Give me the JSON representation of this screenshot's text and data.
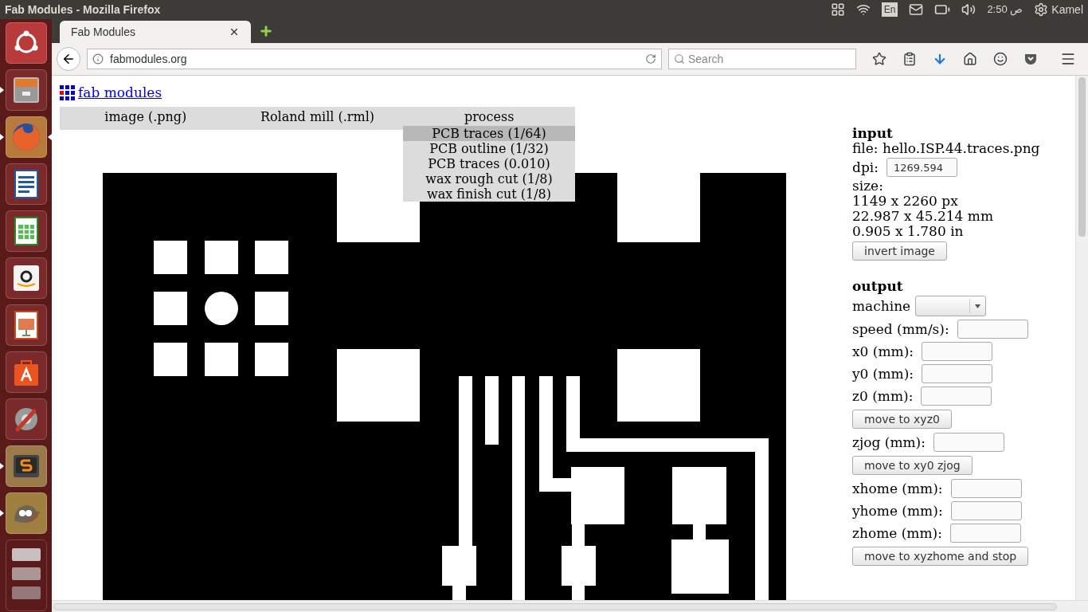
{
  "topbar": {
    "title": "Fab Modules - Mozilla Firefox",
    "keyboard": "En",
    "clock": "ص 2:50",
    "user": "Kamel"
  },
  "launcher": [
    {
      "kind": "ubuntu",
      "running": false,
      "focused": false
    },
    {
      "kind": "files",
      "running": true,
      "focused": false
    },
    {
      "kind": "firefox",
      "running": true,
      "focused": true
    },
    {
      "kind": "writer",
      "running": false,
      "focused": false
    },
    {
      "kind": "calc",
      "running": false,
      "focused": false
    },
    {
      "kind": "amazon",
      "running": false,
      "focused": false
    },
    {
      "kind": "impress",
      "running": false,
      "focused": false
    },
    {
      "kind": "store",
      "running": false,
      "focused": false
    },
    {
      "kind": "settings",
      "running": false,
      "focused": false
    },
    {
      "kind": "sublime",
      "running": true,
      "focused": false
    },
    {
      "kind": "gimp",
      "running": true,
      "focused": false
    },
    {
      "kind": "drives",
      "running": false,
      "focused": false
    }
  ],
  "browser": {
    "tab": {
      "title": "Fab Modules"
    },
    "url": "fabmodules.org",
    "search": {
      "placeholder": "Search"
    }
  },
  "page": {
    "logo_link": "fab modules",
    "menu": [
      {
        "label": "image (.png)"
      },
      {
        "label": "Roland mill (.rml)"
      },
      {
        "label": "process"
      }
    ],
    "process_menu": [
      {
        "label": "PCB traces (1/64)",
        "selected": true
      },
      {
        "label": "PCB outline (1/32)",
        "selected": false
      },
      {
        "label": "PCB traces (0.010)",
        "selected": false
      },
      {
        "label": "wax rough cut (1/8)",
        "selected": false
      },
      {
        "label": "wax finish cut (1/8)",
        "selected": false
      }
    ],
    "panel": [
      {
        "kind": "heading",
        "text": "input"
      },
      {
        "kind": "text",
        "text": "file: hello.ISP.44.traces.png"
      },
      {
        "kind": "field",
        "label": "dpi:",
        "value": "1269.594"
      },
      {
        "kind": "text",
        "text": "size:"
      },
      {
        "kind": "text",
        "text": "1149 x 2260 px"
      },
      {
        "kind": "text",
        "text": "22.987 x 45.214 mm"
      },
      {
        "kind": "text",
        "text": "0.905 x 1.780 in"
      },
      {
        "kind": "button",
        "text": "invert image"
      },
      {
        "kind": "heading",
        "text": "output"
      },
      {
        "kind": "select",
        "label": "machine"
      },
      {
        "kind": "field",
        "label": "speed (mm/s):"
      },
      {
        "kind": "field",
        "label": "x0 (mm):"
      },
      {
        "kind": "field",
        "label": "y0 (mm):"
      },
      {
        "kind": "field",
        "label": "z0 (mm):"
      },
      {
        "kind": "button",
        "text": "move to xyz0"
      },
      {
        "kind": "field",
        "label": "zjog (mm):"
      },
      {
        "kind": "button",
        "text": "move to xy0 zjog"
      },
      {
        "kind": "field",
        "label": "xhome (mm):"
      },
      {
        "kind": "field",
        "label": "yhome (mm):"
      },
      {
        "kind": "field",
        "label": "zhome (mm):"
      },
      {
        "kind": "button",
        "text": "move to xyzhome and stop"
      }
    ]
  }
}
